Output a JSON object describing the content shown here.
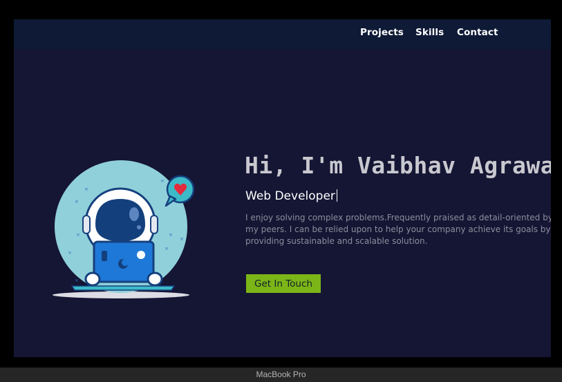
{
  "nav": {
    "items": [
      {
        "label": "Projects"
      },
      {
        "label": "Skills"
      },
      {
        "label": "Contact"
      }
    ]
  },
  "hero": {
    "title": "Hi, I'm Vaibhav Agrawal",
    "subtitle": "Web Developer",
    "bio": "I enjoy solving complex problems.Frequently praised as detail-oriented by my peers. I can be relied upon to help your company achieve its goals by providing sustainable and scalable solution.",
    "cta_label": "Get In Touch",
    "illustration_icon": "astronaut-laptop-illustration"
  },
  "device": {
    "label": "MacBook Pro"
  },
  "colors": {
    "page_background": "#151534",
    "navbar_background": "#0e1a36",
    "accent": "#7cb518",
    "title_text": "#c8c8cf",
    "body_text": "#8e8e9c"
  }
}
